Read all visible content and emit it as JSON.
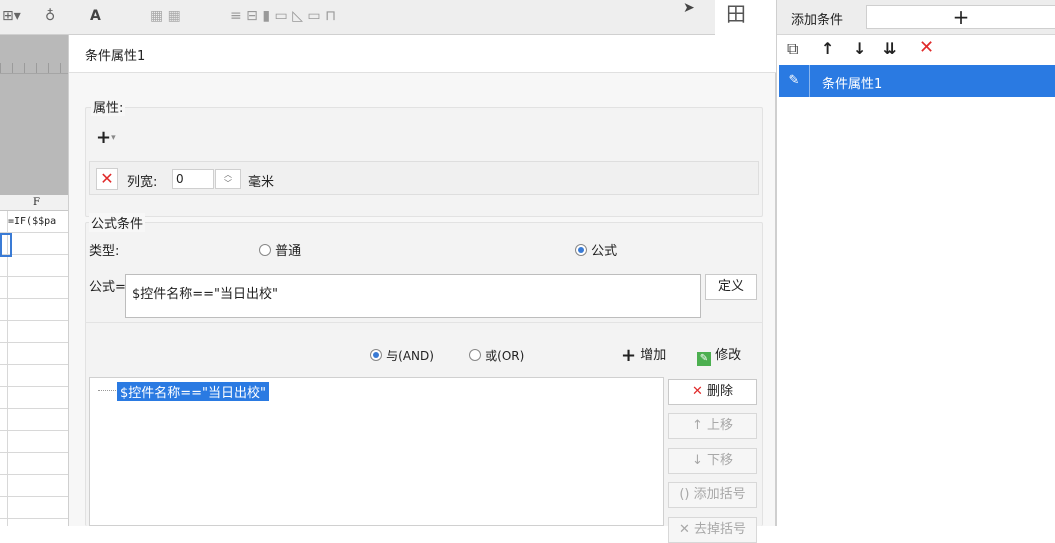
{
  "right_panel": {
    "add_condition_label": "添加条件",
    "add_plus": "+",
    "tools": [
      "copy-icon",
      "arrow-up-icon",
      "arrow-down-icon",
      "move-bottom-icon",
      "delete-icon"
    ],
    "items": [
      {
        "label": "条件属性1",
        "selected": true
      }
    ]
  },
  "background": {
    "column_letter": "F",
    "cell_formula": "=IF($$pa",
    "toolbar_corner_icon": "田"
  },
  "dialog": {
    "title": "条件属性1",
    "properties": {
      "label": "属性:",
      "add_button": "+",
      "column_width_label": "列宽:",
      "column_width_value": "0",
      "unit": "毫米"
    },
    "formula_condition": {
      "label": "公式条件",
      "type_label": "类型:",
      "option_normal": "普通",
      "option_formula": "公式",
      "selected_type": "公式",
      "formula_label": "公式=",
      "formula_value": "$控件名称==\"当日出校\"",
      "define_button": "定义",
      "logic_and": "与(AND)",
      "logic_or": "或(OR)",
      "selected_logic": "与(AND)",
      "add_button": "增加",
      "modify_button": "修改",
      "tree_items": [
        "$控件名称==\"当日出校\""
      ],
      "delete_button": "删除",
      "move_up_button": "上移",
      "move_down_button": "下移",
      "add_bracket_button": "添加括号",
      "remove_bracket_button": "去掉括号"
    }
  },
  "colors": {
    "accent": "#2a7ae2",
    "delete_red": "#e02a2a"
  }
}
